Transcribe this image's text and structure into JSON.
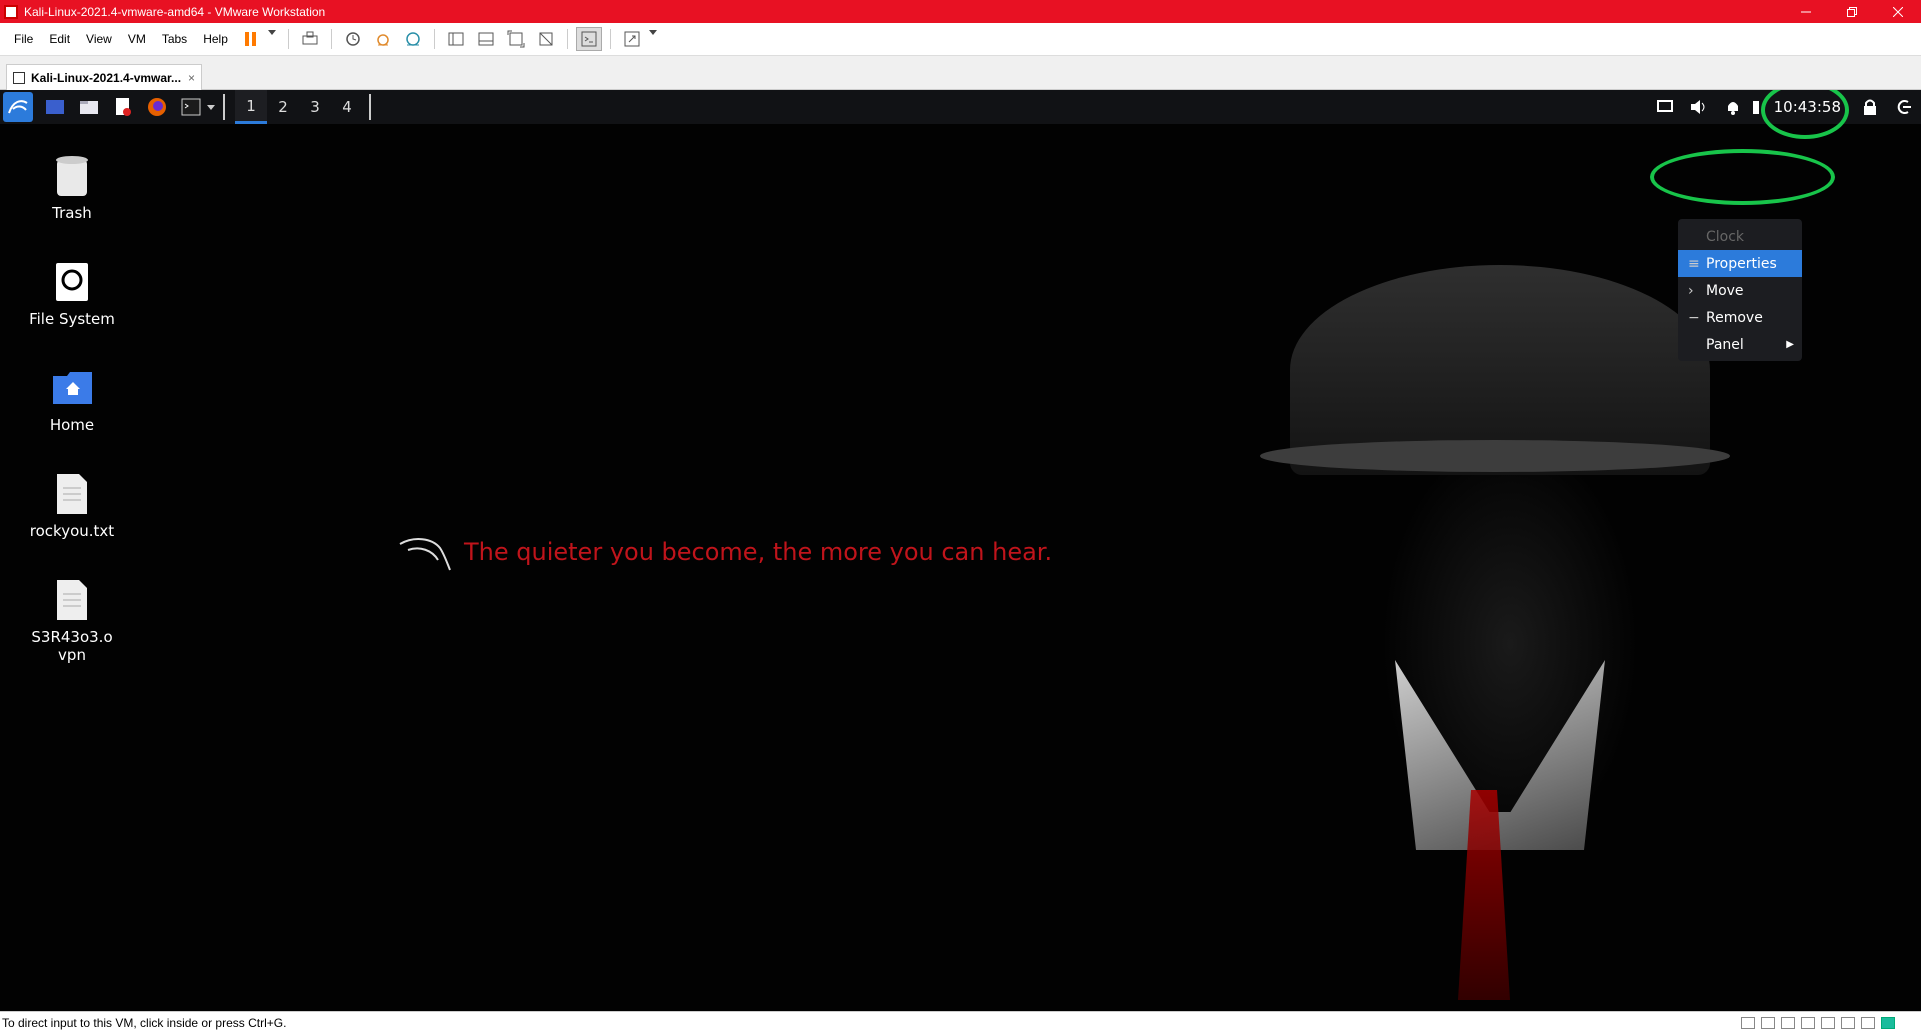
{
  "window": {
    "title": "Kali-Linux-2021.4-vmware-amd64 - VMware Workstation"
  },
  "menubar": {
    "items": [
      "File",
      "Edit",
      "View",
      "VM",
      "Tabs",
      "Help"
    ]
  },
  "tab": {
    "label": "Kali-Linux-2021.4-vmwar...",
    "close": "×"
  },
  "panel": {
    "workspaces": [
      "1",
      "2",
      "3",
      "4"
    ],
    "active_workspace": "1",
    "clock": "10:43:58"
  },
  "desktop": {
    "icons": [
      {
        "label": "Trash",
        "icon": "trash-icon"
      },
      {
        "label": "File System",
        "icon": "drive-icon"
      },
      {
        "label": "Home",
        "icon": "home-folder-icon"
      },
      {
        "label": "rockyou.txt",
        "icon": "text-file-icon"
      },
      {
        "label": "S3R43o3.ovpn",
        "icon": "text-file-icon"
      }
    ],
    "slogan": "The quieter you become, the more you can hear."
  },
  "context_menu": {
    "items": [
      {
        "label": "Clock",
        "state": "disabled"
      },
      {
        "label": "Properties",
        "state": "selected"
      },
      {
        "label": "Move",
        "state": "normal"
      },
      {
        "label": "Remove",
        "state": "normal"
      },
      {
        "label": "Panel",
        "state": "submenu"
      }
    ]
  },
  "statusbar": {
    "hint": "To direct input to this VM, click inside or press Ctrl+G."
  },
  "colors": {
    "vmware_title": "#e81123",
    "kali_accent": "#2c7bdb",
    "slogan_red": "#c0141b",
    "annotation_green": "#18c44a"
  }
}
